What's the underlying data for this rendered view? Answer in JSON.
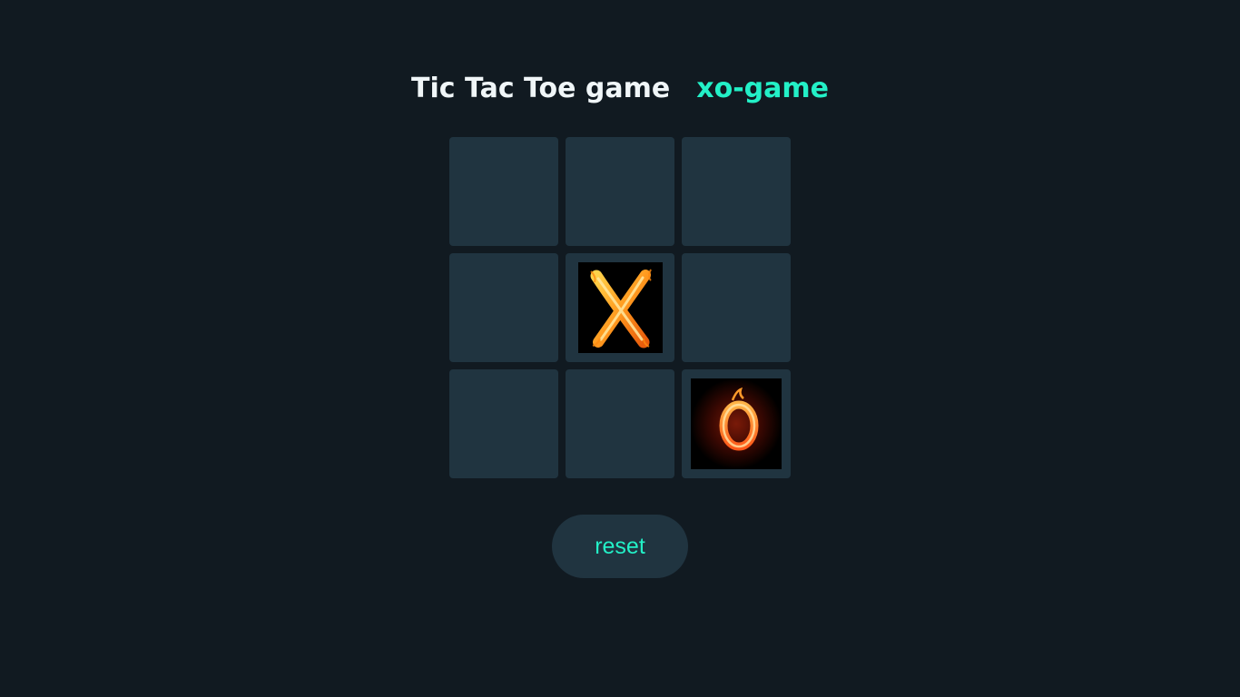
{
  "header": {
    "title": "Tic Tac Toe game",
    "subtitle": "xo-game"
  },
  "board": {
    "cells": [
      "",
      "",
      "",
      "",
      "X",
      "",
      "",
      "",
      "O"
    ]
  },
  "controls": {
    "reset_label": "reset"
  },
  "colors": {
    "background": "#111a21",
    "cell": "#203440",
    "accent": "#23f0c7",
    "title": "#f0f6f8"
  },
  "icons": {
    "x": "fire-x-icon",
    "o": "fire-o-icon"
  }
}
